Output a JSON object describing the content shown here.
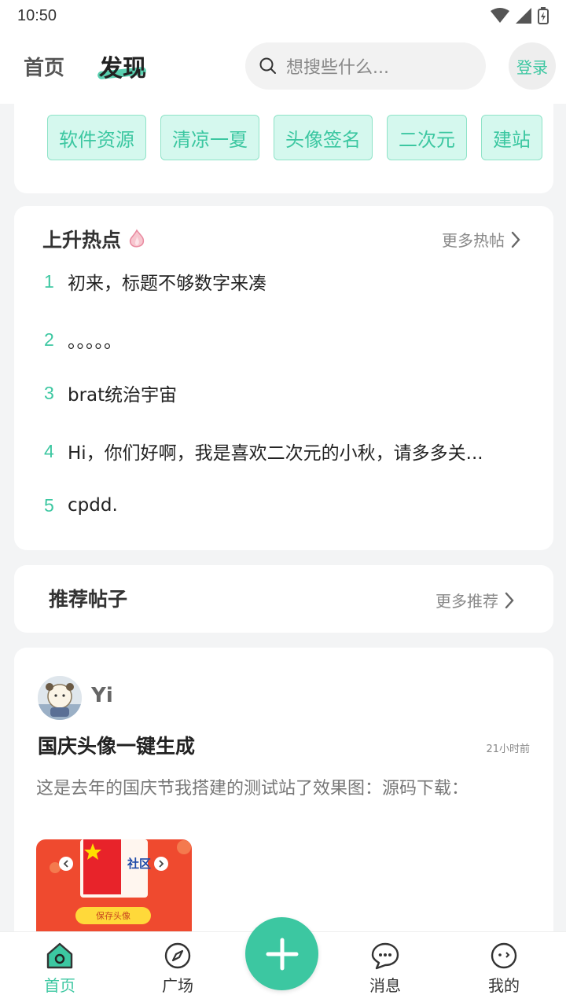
{
  "status_bar": {
    "time": "10:50"
  },
  "header": {
    "tab_home": "首页",
    "tab_discover": "发现",
    "search_placeholder": "想搜些什么...",
    "login_label": "登录"
  },
  "tags": [
    "软件资源",
    "清凉一夏",
    "头像签名",
    "二次元",
    "建站"
  ],
  "hot": {
    "title": "上升热点",
    "more_label": "更多热帖",
    "items": [
      {
        "rank": "1",
        "title": "初来，标题不够数字来凑"
      },
      {
        "rank": "2",
        "title": "。。。。。"
      },
      {
        "rank": "3",
        "title": "brat统治宇宙"
      },
      {
        "rank": "4",
        "title": "Hi，你们好啊，我是喜欢二次元的小秋，请多多关..."
      },
      {
        "rank": "5",
        "title": "cpdd."
      }
    ]
  },
  "recommend": {
    "title": "推荐帖子",
    "more_label": "更多推荐"
  },
  "post": {
    "author": "Yi",
    "title": "国庆头像一键生成",
    "time": "21小时前",
    "excerpt": "这是去年的国庆节我搭建的测试站了效果图：源码下载：",
    "image_text": "社区",
    "image_button": "保存头像"
  },
  "bottom_nav": {
    "items": [
      {
        "label": "首页",
        "icon": "home-icon"
      },
      {
        "label": "广场",
        "icon": "compass-icon"
      },
      {
        "label": "消息",
        "icon": "chat-icon"
      },
      {
        "label": "我的",
        "icon": "profile-face-icon"
      }
    ],
    "fab_icon": "plus-icon"
  },
  "colors": {
    "accent": "#3cc7a1",
    "tag_bg": "#d5f8ee",
    "fab": "#3cc7a1"
  }
}
